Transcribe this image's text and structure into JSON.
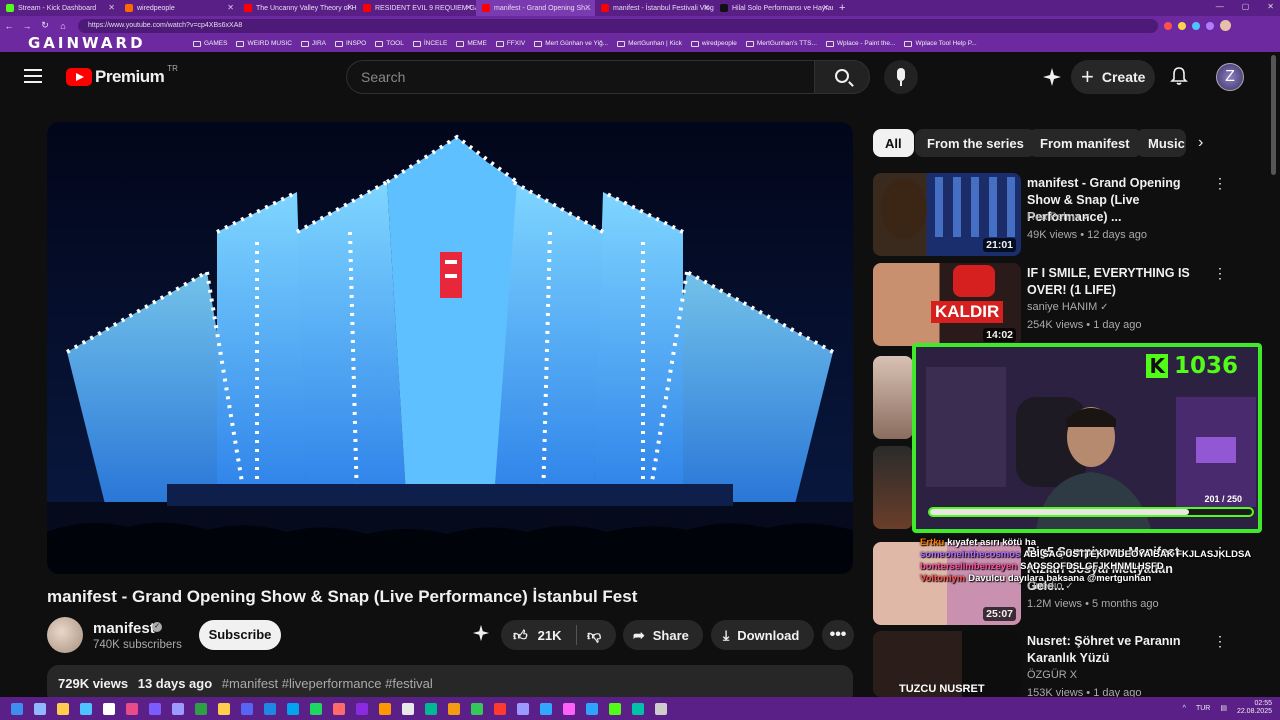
{
  "browser": {
    "tabs": [
      {
        "title": "Stream - Kick Dashboard",
        "color": "#53fc18"
      },
      {
        "title": "wiredpeople",
        "color": "#ff6a00"
      },
      {
        "title": "The Uncanny Valley Theory of Hu...",
        "color": "#ff0000"
      },
      {
        "title": "RESIDENT EVIL 9 REQUIEM Game...",
        "color": "#ff0000"
      },
      {
        "title": "manifest - Grand Opening Sh...",
        "color": "#ff0000"
      },
      {
        "title": "manifest - İstanbul Festivali Vlog",
        "color": "#ff0000"
      },
      {
        "title": "Hilal Solo Performansı ve Hayran...",
        "color": "#111111"
      }
    ],
    "url": "https://www.youtube.com/watch?v=cp4XBs6xXA8",
    "overlay_brand": "GAINWARD",
    "bookmarks": [
      "GAMES",
      "WEIRD MUSIC",
      "JIRA",
      "INSPO",
      "TOOL",
      "İNCELE",
      "MEME",
      "FFXIV",
      "Mert Günhan ve Yiğ...",
      "MertGunhan | Kick",
      "wiredpeople",
      "MertGunhan's TTS...",
      "Wplace - Paint the...",
      "Wplace Tool Help P..."
    ]
  },
  "header": {
    "brand": "Premium",
    "country": "TR",
    "search_placeholder": "Search",
    "create_label": "Create",
    "avatar_glyph": "Z"
  },
  "video": {
    "title": "manifest - Grand Opening Show & Snap (Live Performance) İstanbul Fest",
    "channel": "manifest",
    "subscribers": "740K subscribers",
    "subscribe_label": "Subscribe",
    "likes": "21K",
    "share_label": "Share",
    "download_label": "Download",
    "views": "729K views",
    "age": "13 days ago",
    "hashtags": "#manifest #liveperformance #festival"
  },
  "chips": [
    "All",
    "From the series",
    "From manifest",
    "Music"
  ],
  "recommendations": [
    {
      "title": "manifest - Grand Opening Show & Snap (Live Performance) ...",
      "channel": "RealPelmx",
      "meta": "49K views • 12 days ago",
      "duration": "21:01",
      "verified": true
    },
    {
      "title": "IF I SMILE, EVERYTHING IS OVER! (1 LIFE)",
      "channel": "saniye HANIM",
      "meta": "254K views • 1 day ago",
      "duration": "14:02",
      "overlay": "KALDIR",
      "verified": true
    },
    {
      "title": "Big5 Şampiyonu Manifest Kızları Sosyal Medyadan Gele...",
      "channel": "Onedio",
      "meta": "1.2M views • 5 months ago",
      "duration": "25:07",
      "verified": true
    },
    {
      "title": "Nusret: Şöhret ve Paranın Karanlık Yüzü",
      "channel": "ÖZGÜR X",
      "meta": "153K views • 1 day ago",
      "duration": "",
      "thumb_text": "TUZCU NUSRET",
      "verified": false
    }
  ],
  "stream_overlay": {
    "kick_logo": "K",
    "viewer_count": "1036",
    "goal_text": "201 / 250",
    "goal_progress": 0.804
  },
  "chat": [
    {
      "user": "Ertku",
      "user_color": "#ff7b00",
      "msg": "kıyafet asırı kötü ha"
    },
    {
      "user": "someoneinthecosmos",
      "user_color": "#b06cff",
      "msg": "ABİ SAĞ ÜSTTEKİ VİDEOYA BAK FKJLASJKLDSA"
    },
    {
      "user": "bonterselimbenzeyen",
      "user_color": "#ff4fa0",
      "msg": "SADSSOFDSLGFJKHNMLHŞFD"
    },
    {
      "user": "Voltoniym",
      "user_color": "#ff5454",
      "msg": "Davulcu dayılara baksana @mertgunhan"
    }
  ],
  "taskbar": {
    "lang": "TUR",
    "time": "02:55",
    "date": "22.08.2025"
  }
}
